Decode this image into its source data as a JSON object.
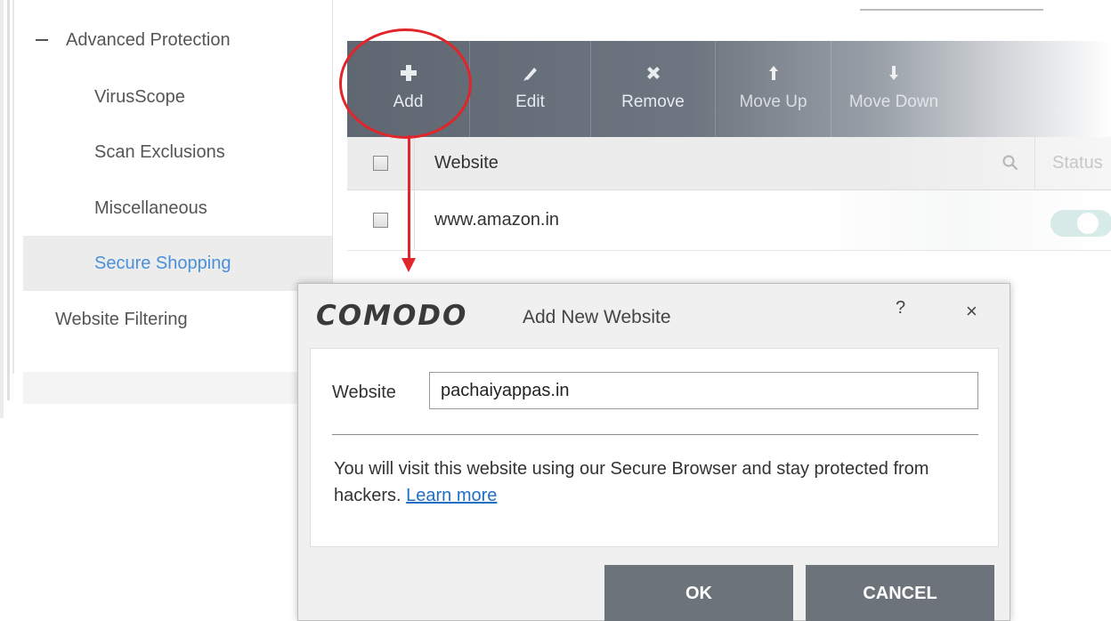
{
  "sidebar": {
    "items": [
      {
        "label": "Advanced Protection"
      },
      {
        "label": "VirusScope"
      },
      {
        "label": "Scan Exclusions"
      },
      {
        "label": "Miscellaneous"
      },
      {
        "label": "Secure Shopping"
      },
      {
        "label": "Website Filtering"
      }
    ]
  },
  "toolbar": {
    "buttons": [
      {
        "label": "Add",
        "icon": "plus-icon"
      },
      {
        "label": "Edit",
        "icon": "pencil-icon"
      },
      {
        "label": "Remove",
        "icon": "x-icon"
      },
      {
        "label": "Move Up",
        "icon": "arrow-up-icon"
      },
      {
        "label": "Move Down",
        "icon": "arrow-down-icon"
      }
    ]
  },
  "table": {
    "columns": [
      "Website",
      "Status"
    ],
    "rows": [
      {
        "website": "www.amazon.in"
      }
    ]
  },
  "dialog": {
    "brand": "COMODO",
    "title": "Add New Website",
    "help": "?",
    "close": "×",
    "website_label": "Website",
    "website_value": "pachaiyappas.in",
    "message": "You will visit this website using our Secure Browser and stay protected from hackers.",
    "learn_more": "Learn more",
    "ok_label": "OK",
    "cancel_label": "CANCEL"
  },
  "colors": {
    "accent": "#4a90d9",
    "toolbar": "#5f6772",
    "annotation": "#e0262b",
    "button": "#6c737b"
  }
}
